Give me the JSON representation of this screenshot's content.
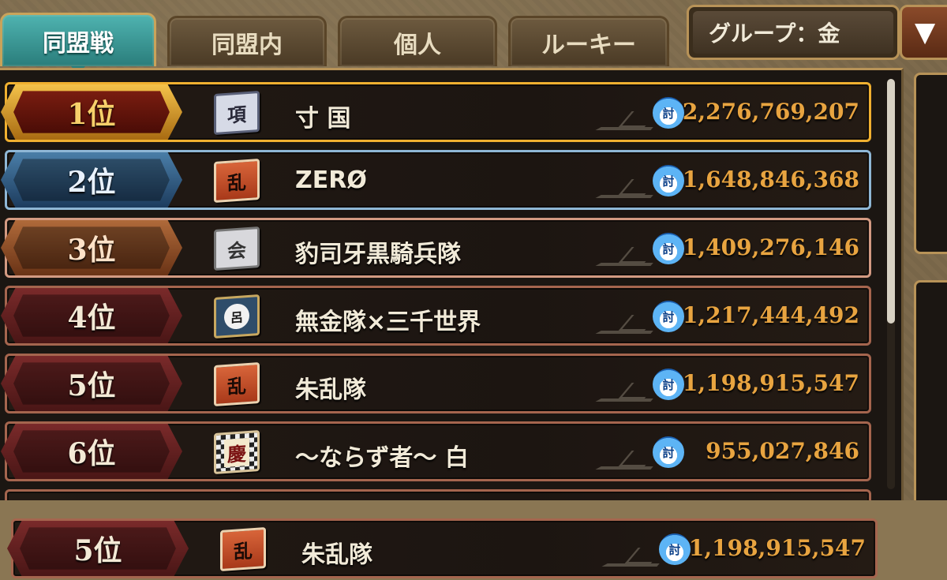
{
  "tabs": [
    {
      "label": "同盟戦",
      "active": true
    },
    {
      "label": "同盟内",
      "active": false
    },
    {
      "label": "個人",
      "active": false
    },
    {
      "label": "ルーキー",
      "active": false
    }
  ],
  "group_selector": {
    "label": "グループ：金",
    "dropdown_icon": "▼"
  },
  "score_icon_label": "討",
  "rankings": [
    {
      "rank": "1位",
      "flag_char": "項",
      "name": "寸 国",
      "score": "2,276,769,207"
    },
    {
      "rank": "2位",
      "flag_char": "乱",
      "name": "ZERØ",
      "score": "1,648,846,368"
    },
    {
      "rank": "3位",
      "flag_char": "会",
      "name": "豹司牙黒騎兵隊",
      "score": "1,409,276,146"
    },
    {
      "rank": "4位",
      "flag_char": "呂",
      "name": "無金隊×三千世界",
      "score": "1,217,444,492"
    },
    {
      "rank": "5位",
      "flag_char": "乱",
      "name": "朱乱隊",
      "score": "1,198,915,547"
    },
    {
      "rank": "6位",
      "flag_char": "慶",
      "name": "〜ならず者〜 白",
      "score": "955,027,846"
    }
  ],
  "my_ranking": {
    "rank": "5位",
    "flag_char": "乱",
    "name": "朱乱隊",
    "score": "1,198,915,547"
  },
  "colors": {
    "gold": "#f0b030",
    "silver_blue": "#8fb7d6",
    "bronze": "#d39a82",
    "score": "#e8a440",
    "tab_active": "#3a9894"
  }
}
